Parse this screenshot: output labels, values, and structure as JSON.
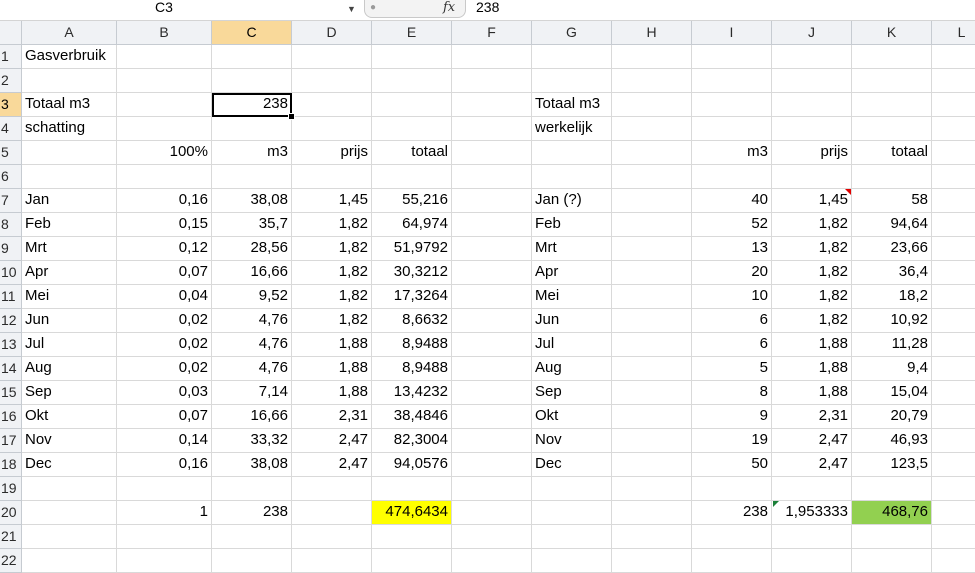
{
  "formula_bar": {
    "name_box": "C3",
    "fx_label": "fx",
    "formula_value": "238"
  },
  "columns": [
    "A",
    "B",
    "C",
    "D",
    "E",
    "F",
    "G",
    "H",
    "I",
    "J",
    "K",
    "L"
  ],
  "selected_column": "C",
  "selected_row": 3,
  "rows": [
    {
      "n": 1,
      "A": "Gasverbruik"
    },
    {
      "n": 2
    },
    {
      "n": 3,
      "A": "Totaal m3",
      "C": "238",
      "G": "Totaal m3"
    },
    {
      "n": 4,
      "A": "schatting",
      "G": "werkelijk"
    },
    {
      "n": 5,
      "B": "100%",
      "C": "m3",
      "D": "prijs",
      "E": "totaal",
      "I": "m3",
      "J": "prijs",
      "K": "totaal"
    },
    {
      "n": 6
    },
    {
      "n": 7,
      "A": "Jan",
      "B": "0,16",
      "C": "38,08",
      "D": "1,45",
      "E": "55,216",
      "G": "Jan (?)",
      "I": "40",
      "J": "1,45",
      "K": "58"
    },
    {
      "n": 8,
      "A": "Feb",
      "B": "0,15",
      "C": "35,7",
      "D": "1,82",
      "E": "64,974",
      "G": "Feb",
      "I": "52",
      "J": "1,82",
      "K": "94,64"
    },
    {
      "n": 9,
      "A": "Mrt",
      "B": "0,12",
      "C": "28,56",
      "D": "1,82",
      "E": "51,9792",
      "G": "Mrt",
      "I": "13",
      "J": "1,82",
      "K": "23,66"
    },
    {
      "n": 10,
      "A": "Apr",
      "B": "0,07",
      "C": "16,66",
      "D": "1,82",
      "E": "30,3212",
      "G": "Apr",
      "I": "20",
      "J": "1,82",
      "K": "36,4"
    },
    {
      "n": 11,
      "A": "Mei",
      "B": "0,04",
      "C": "9,52",
      "D": "1,82",
      "E": "17,3264",
      "G": "Mei",
      "I": "10",
      "J": "1,82",
      "K": "18,2"
    },
    {
      "n": 12,
      "A": "Jun",
      "B": "0,02",
      "C": "4,76",
      "D": "1,82",
      "E": "8,6632",
      "G": "Jun",
      "I": "6",
      "J": "1,82",
      "K": "10,92"
    },
    {
      "n": 13,
      "A": "Jul",
      "B": "0,02",
      "C": "4,76",
      "D": "1,88",
      "E": "8,9488",
      "G": "Jul",
      "I": "6",
      "J": "1,88",
      "K": "11,28"
    },
    {
      "n": 14,
      "A": "Aug",
      "B": "0,02",
      "C": "4,76",
      "D": "1,88",
      "E": "8,9488",
      "G": "Aug",
      "I": "5",
      "J": "1,88",
      "K": "9,4"
    },
    {
      "n": 15,
      "A": "Sep",
      "B": "0,03",
      "C": "7,14",
      "D": "1,88",
      "E": "13,4232",
      "G": "Sep",
      "I": "8",
      "J": "1,88",
      "K": "15,04"
    },
    {
      "n": 16,
      "A": "Okt",
      "B": "0,07",
      "C": "16,66",
      "D": "2,31",
      "E": "38,4846",
      "G": "Okt",
      "I": "9",
      "J": "2,31",
      "K": "20,79"
    },
    {
      "n": 17,
      "A": "Nov",
      "B": "0,14",
      "C": "33,32",
      "D": "2,47",
      "E": "82,3004",
      "G": "Nov",
      "I": "19",
      "J": "2,47",
      "K": "46,93"
    },
    {
      "n": 18,
      "A": "Dec",
      "B": "0,16",
      "C": "38,08",
      "D": "2,47",
      "E": "94,0576",
      "G": "Dec",
      "I": "50",
      "J": "2,47",
      "K": "123,5"
    },
    {
      "n": 19
    },
    {
      "n": 20,
      "B": "1",
      "C": "238",
      "E": "474,6434",
      "I": "238",
      "J": "1,953333",
      "K": "468,76"
    },
    {
      "n": 21
    },
    {
      "n": 22
    }
  ],
  "highlights": {
    "E20": "#ffff00",
    "K20": "#92d050"
  },
  "comment_markers": [
    "J7"
  ],
  "error_markers": [
    "J20"
  ]
}
